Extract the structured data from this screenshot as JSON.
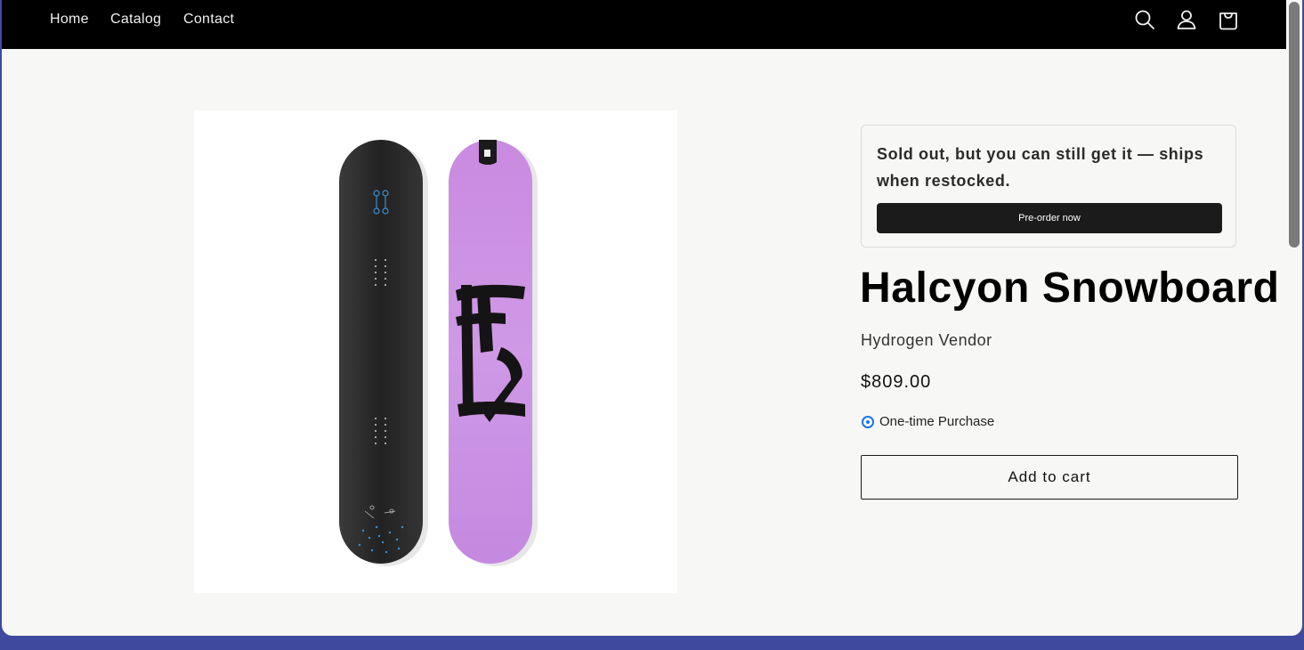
{
  "nav": {
    "links": [
      {
        "label": "Home"
      },
      {
        "label": "Catalog"
      },
      {
        "label": "Contact"
      }
    ],
    "icons": [
      "search-icon",
      "account-icon",
      "cart-icon"
    ]
  },
  "preorder": {
    "message": "Sold out, but you can still get it — ships when restocked.",
    "button_label": "Pre-order now"
  },
  "product": {
    "title": "Halcyon Snowboard",
    "vendor": "Hydrogen Vendor",
    "price": "$809.00",
    "purchase_option": "One-time Purchase",
    "add_to_cart_label": "Add to cart",
    "board_colors": {
      "left": "#2a2a2a",
      "right": "#c88ee3"
    }
  },
  "colors": {
    "nav_background": "#000000",
    "page_background": "#f7f7f5",
    "accent_radio": "#1a73e8"
  }
}
